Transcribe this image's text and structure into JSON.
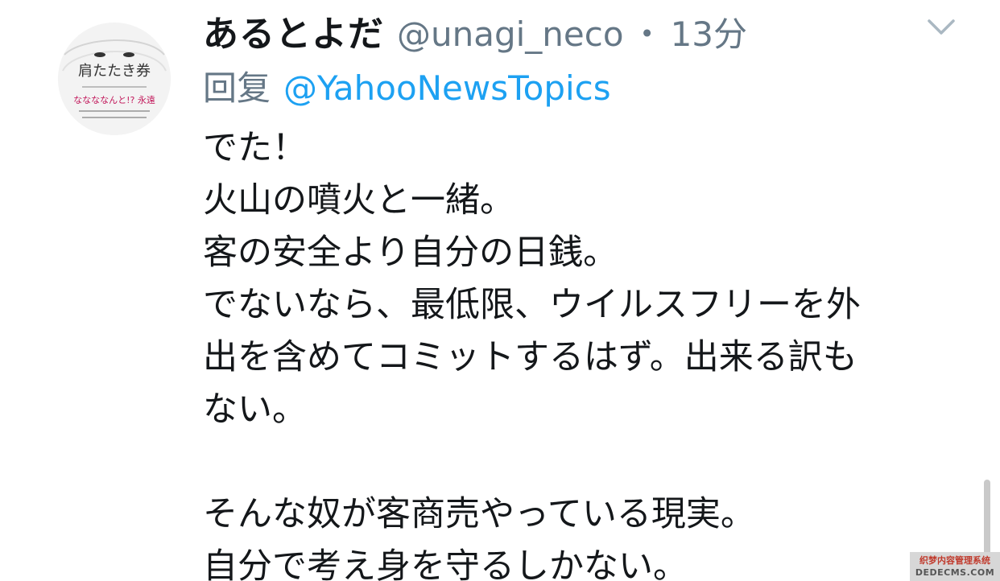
{
  "tweet": {
    "author": {
      "display_name": "あるとよだ",
      "handle": "@unagi_neco",
      "avatar": {
        "title": "肩たたき券",
        "subtitle": "ななななんと!? 永遠"
      }
    },
    "separator": "・",
    "time": "13分",
    "reply_label": "回复",
    "reply_target": "@YahooNewsTopics",
    "text_lines": [
      "でた！",
      "火山の噴火と一緒。",
      "客の安全より自分の日銭。",
      "でないなら、最低限、ウイルスフリーを外",
      "出を含めてコミットするはず。出来る訳も",
      "ない。",
      "",
      "そんな奴が客商売やっている現実。",
      "自分で考え身を守るしかない。"
    ],
    "menu_icon": "chevron-down-icon"
  },
  "watermark": {
    "line1": "织梦内容管理系统",
    "line2": "DEDECMS.COM"
  },
  "colors": {
    "text": "#14171a",
    "secondary": "#657786",
    "link": "#1da1f2"
  }
}
